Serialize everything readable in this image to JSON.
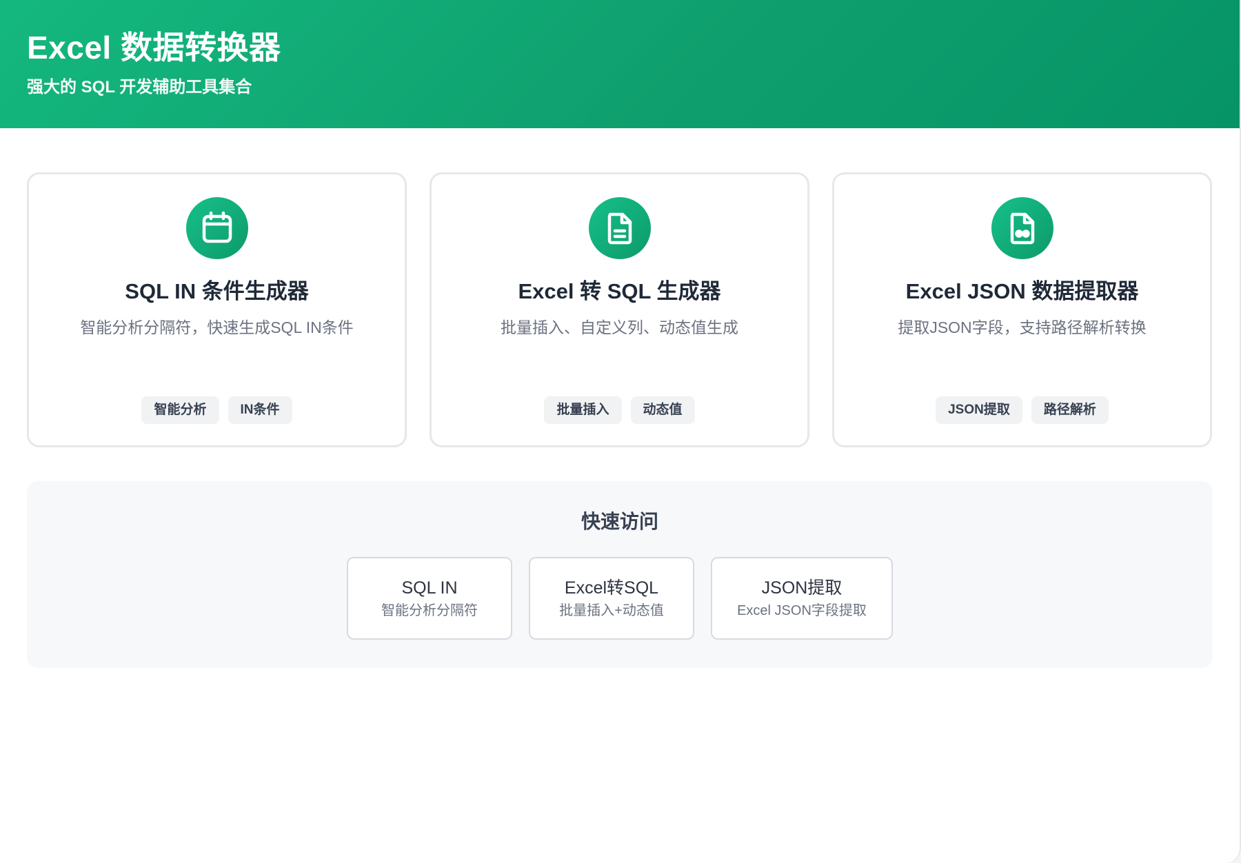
{
  "header": {
    "title": "Excel 数据转换器",
    "subtitle": "强大的 SQL 开发辅助工具集合"
  },
  "tools": [
    {
      "icon": "calendar-icon",
      "title": "SQL IN 条件生成器",
      "description": "智能分析分隔符，快速生成SQL IN条件",
      "tags": [
        "智能分析",
        "IN条件"
      ]
    },
    {
      "icon": "document-icon",
      "title": "Excel 转 SQL 生成器",
      "description": "批量插入、自定义列、动态值生成",
      "tags": [
        "批量插入",
        "动态值"
      ]
    },
    {
      "icon": "json-file-icon",
      "title": "Excel JSON 数据提取器",
      "description": "提取JSON字段，支持路径解析转换",
      "tags": [
        "JSON提取",
        "路径解析"
      ]
    }
  ],
  "quick_access": {
    "title": "快速访问",
    "links": [
      {
        "name": "SQL IN",
        "subtitle": "智能分析分隔符"
      },
      {
        "name": "Excel转SQL",
        "subtitle": "批量插入+动态值"
      },
      {
        "name": "JSON提取",
        "subtitle": "Excel JSON字段提取"
      }
    ]
  },
  "colors": {
    "brand": "#10b981",
    "brand_dark": "#069466",
    "title_text": "#1f2937",
    "muted_text": "#6b7280"
  }
}
